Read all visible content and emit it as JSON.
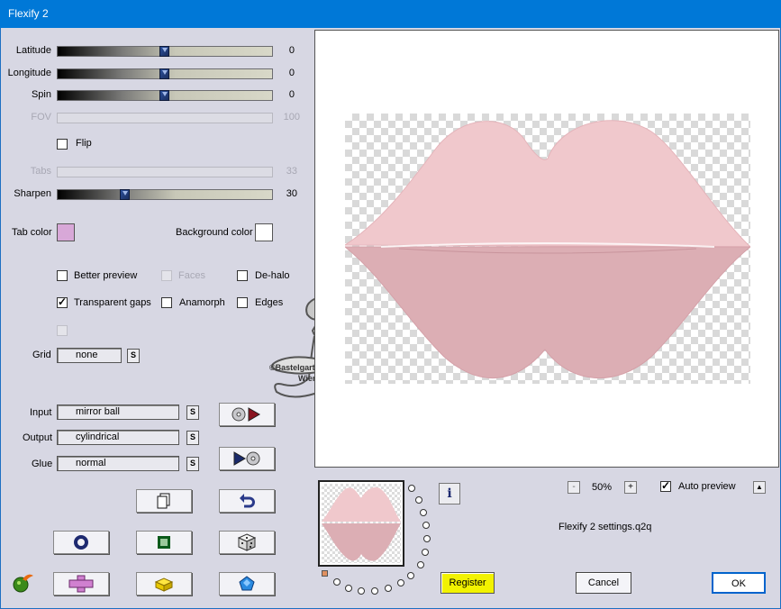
{
  "window": {
    "title": "Flexify 2"
  },
  "sliders": {
    "latitude": {
      "label": "Latitude",
      "value": "0",
      "level": 0.5
    },
    "longitude": {
      "label": "Longitude",
      "value": "0",
      "level": 0.5
    },
    "spin": {
      "label": "Spin",
      "value": "0",
      "level": 0.5
    },
    "fov": {
      "label": "FOV",
      "value": "100",
      "level": 1.0
    },
    "tabs": {
      "label": "Tabs",
      "value": "33",
      "level": 0.33
    },
    "sharpen": {
      "label": "Sharpen",
      "value": "30",
      "level": 0.3
    }
  },
  "options": {
    "flip": {
      "label": "Flip",
      "checked": false
    },
    "better_preview": {
      "label": "Better preview",
      "checked": false
    },
    "faces": {
      "label": "Faces",
      "checked": false
    },
    "de_halo": {
      "label": "De-halo",
      "checked": false
    },
    "transparent_gaps": {
      "label": "Transparent gaps",
      "checked": true
    },
    "anamorph": {
      "label": "Anamorph",
      "checked": false
    },
    "edges": {
      "label": "Edges",
      "checked": false
    }
  },
  "colors": {
    "tab_color_label": "Tab color",
    "tab_color": "#d8a8d8",
    "background_color_label": "Background color",
    "background_color": "#ffffff",
    "shape_color": "#f0c8cc",
    "accent": "#0078d7"
  },
  "grid": {
    "label": "Grid",
    "value": "none",
    "s_label": "S"
  },
  "mapping": {
    "input": {
      "label": "Input",
      "value": "mirror ball",
      "s_label": "S"
    },
    "output": {
      "label": "Output",
      "value": "cylindrical",
      "s_label": "S"
    },
    "glue": {
      "label": "Glue",
      "value": "normal",
      "s_label": "S"
    }
  },
  "watermark": {
    "line1": "©Bastelgarten",
    "line2": "Wien"
  },
  "zoom": {
    "minus": "-",
    "value": "50%",
    "plus": "+"
  },
  "auto_preview": {
    "label": "Auto preview",
    "checked": true,
    "arrow": "▲"
  },
  "info_label": "i",
  "settings_file": "Flexify 2 settings.q2q",
  "buttons": {
    "register": "Register",
    "cancel": "Cancel",
    "ok": "OK"
  },
  "icons": {
    "swap_in": "disc-to-arrow-icon",
    "swap_out": "arrow-to-disc-icon",
    "copy": "copy-icon",
    "undo": "undo-icon",
    "ring": "ring-icon",
    "square": "square-icon",
    "dice": "dice-icon",
    "plus": "cross-icon",
    "brick": "brick-icon",
    "gem": "pentagon-gem-icon",
    "logo": "flaming-fruit-logo-icon"
  }
}
